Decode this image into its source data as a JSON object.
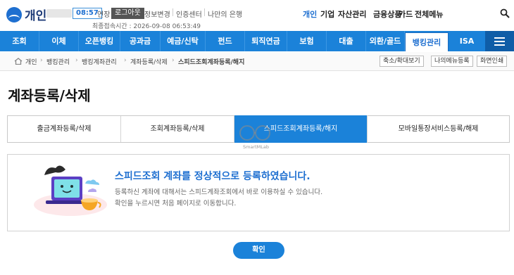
{
  "header": {
    "logo_text": "개인",
    "timer": "08:57",
    "extend_label": "연장",
    "logout_label": "로그아웃",
    "util_links": [
      "정보변경",
      "인증센터",
      "나만의 은행"
    ],
    "last_login": "최종접속시간 : 2026-09-08 06:53:49",
    "segments": [
      "개인",
      "기업",
      "자산관리",
      "금융상품",
      "카드",
      "전체메뉴"
    ],
    "active_segment": "개인"
  },
  "gnb": {
    "items": [
      "조회",
      "이체",
      "오픈뱅킹",
      "공과금",
      "예금/신탁",
      "펀드",
      "퇴직연금",
      "보험",
      "대출",
      "외환/골드",
      "뱅킹관리",
      "ISA"
    ],
    "active": "뱅킹관리"
  },
  "breadcrumb": {
    "items": [
      "개인",
      "뱅킹관리",
      "뱅킹계좌관리",
      "계좌등록/삭제",
      "스피드조회계좌등록/해지"
    ],
    "buttons": [
      "축소/확대보기",
      "나의메뉴등록",
      "화면인쇄"
    ]
  },
  "page": {
    "title": "계좌등록/삭제",
    "tabs": [
      "출금계좌등록/삭제",
      "조회계좌등록/삭제",
      "스피드조회계좌등록/해지",
      "모바일통장서비스등록/해제"
    ],
    "active_tab": "스피드조회계좌등록/해지",
    "watermark": "SmartMLab"
  },
  "result": {
    "title": "스피드조회 계좌를 정상적으로 등록하였습니다.",
    "line1": "등록하신 계좌에 대해서는 스피드계좌조회에서 바로 이용하실 수 있습니다.",
    "line2": "확인을 누르시면 처음 페이지로 이동합니다."
  },
  "confirm_label": "확인",
  "colors": {
    "primary": "#1b82d9",
    "accent_text": "#1e6fd0",
    "menu_dark": "#0f5da7"
  }
}
